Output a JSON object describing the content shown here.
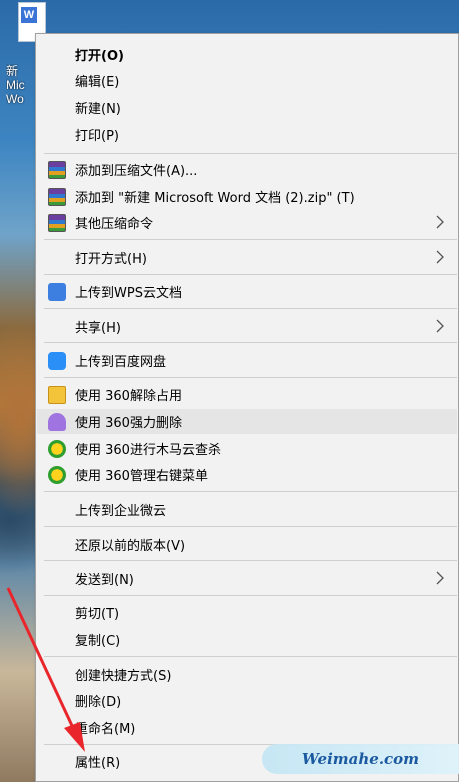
{
  "desktop": {
    "icon_badge": "W",
    "label_lines": [
      "新",
      "Mic",
      "Wo"
    ]
  },
  "menu": {
    "items": [
      {
        "label": "打开(O)",
        "icon": "",
        "arrow": false
      },
      {
        "label": "编辑(E)",
        "icon": "",
        "arrow": false
      },
      {
        "label": "新建(N)",
        "icon": "",
        "arrow": false
      },
      {
        "label": "打印(P)",
        "icon": "",
        "arrow": false
      },
      {
        "label": "添加到压缩文件(A)...",
        "icon": "winrar-icon",
        "arrow": false
      },
      {
        "label": "添加到 \"新建 Microsoft Word 文档 (2).zip\" (T)",
        "icon": "winrar-icon",
        "arrow": false
      },
      {
        "label": "其他压缩命令",
        "icon": "winrar-icon",
        "arrow": true
      },
      {
        "label": "打开方式(H)",
        "icon": "",
        "arrow": true
      },
      {
        "label": "上传到WPS云文档",
        "icon": "wps-cloud-icon",
        "arrow": false
      },
      {
        "label": "共享(H)",
        "icon": "",
        "arrow": true
      },
      {
        "label": "上传到百度网盘",
        "icon": "baidu-netdisk-icon",
        "arrow": false
      },
      {
        "label": "使用 360解除占用",
        "icon": "360-unlock-icon",
        "arrow": false
      },
      {
        "label": "使用 360强力删除",
        "icon": "360-shred-icon",
        "arrow": false
      },
      {
        "label": "使用 360进行木马云查杀",
        "icon": "360-security-icon",
        "arrow": false
      },
      {
        "label": "使用 360管理右键菜单",
        "icon": "360-security-icon",
        "arrow": false
      },
      {
        "label": "上传到企业微云",
        "icon": "",
        "arrow": false
      },
      {
        "label": "还原以前的版本(V)",
        "icon": "",
        "arrow": false
      },
      {
        "label": "发送到(N)",
        "icon": "",
        "arrow": true
      },
      {
        "label": "剪切(T)",
        "icon": "",
        "arrow": false
      },
      {
        "label": "复制(C)",
        "icon": "",
        "arrow": false
      },
      {
        "label": "创建快捷方式(S)",
        "icon": "",
        "arrow": false
      },
      {
        "label": "删除(D)",
        "icon": "",
        "arrow": false
      },
      {
        "label": "重命名(M)",
        "icon": "",
        "arrow": false
      },
      {
        "label": "属性(R)",
        "icon": "",
        "arrow": false
      }
    ],
    "highlighted_item": "使用 360强力删除"
  },
  "watermark": {
    "text": "Weimahe.com"
  },
  "colors": {
    "menu_bg": "#f2f2f2",
    "hover_bg": "#e5e5e5",
    "annotation_arrow": "#e8262b",
    "watermark_text": "#1b5aa0"
  }
}
